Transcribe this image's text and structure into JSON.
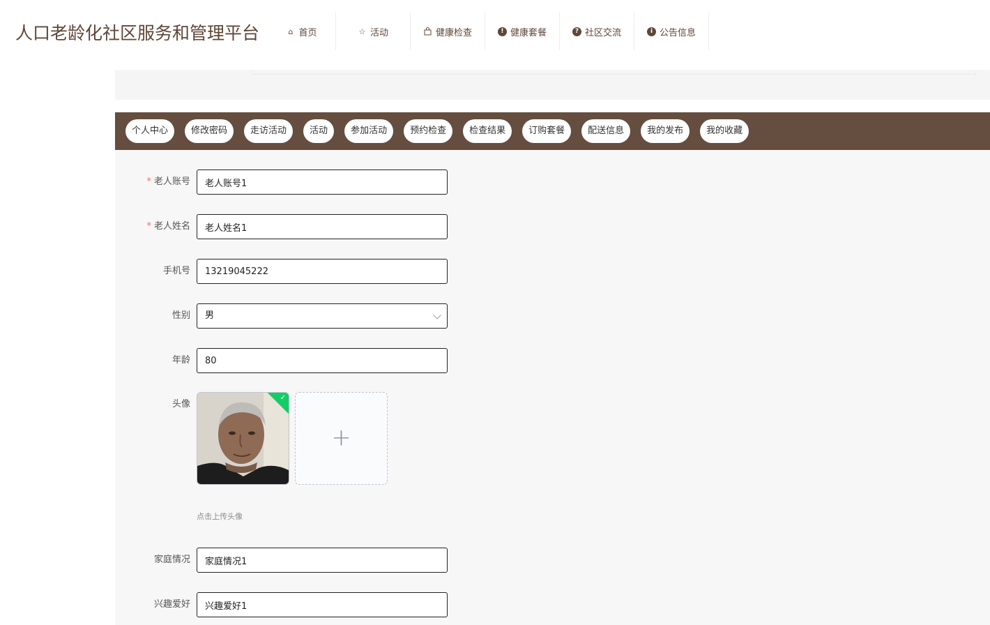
{
  "header": {
    "brand": "人口老龄化社区服务和管理平台",
    "nav": [
      {
        "label": "首页",
        "icon": "home-icon",
        "glyph": "⌂"
      },
      {
        "label": "活动",
        "icon": "star-icon",
        "glyph": "☆"
      },
      {
        "label": "健康检查",
        "icon": "bag-icon",
        "glyph": "◻"
      },
      {
        "label": "健康套餐",
        "icon": "exclamation-circle-icon",
        "glyph": "!"
      },
      {
        "label": "社区交流",
        "icon": "question-circle-icon",
        "glyph": "?"
      },
      {
        "label": "公告信息",
        "icon": "info-circle-icon",
        "glyph": "i"
      }
    ]
  },
  "tabs": [
    "个人中心",
    "修改密码",
    "走访活动",
    "活动",
    "参加活动",
    "预约检查",
    "检查结果",
    "订购套餐",
    "配送信息",
    "我的发布",
    "我的收藏"
  ],
  "form": {
    "account": {
      "label": "老人账号",
      "value": "老人账号1",
      "required": "*"
    },
    "name": {
      "label": "老人姓名",
      "value": "老人姓名1",
      "required": "*"
    },
    "phone": {
      "label": "手机号",
      "value": "13219045222"
    },
    "gender": {
      "label": "性别",
      "value": "男"
    },
    "age": {
      "label": "年龄",
      "value": "80"
    },
    "avatar": {
      "label": "头像",
      "hint": "点击上传头像",
      "plus": "+",
      "check": "✓"
    },
    "family": {
      "label": "家庭情况",
      "value": "家庭情况1"
    },
    "hobby": {
      "label": "兴趣爱好",
      "value": "兴趣爱好1"
    }
  },
  "colors": {
    "brand": "#5f4637",
    "tabbar": "#654e3f",
    "success": "#13ce66",
    "required": "#f56c6c"
  }
}
